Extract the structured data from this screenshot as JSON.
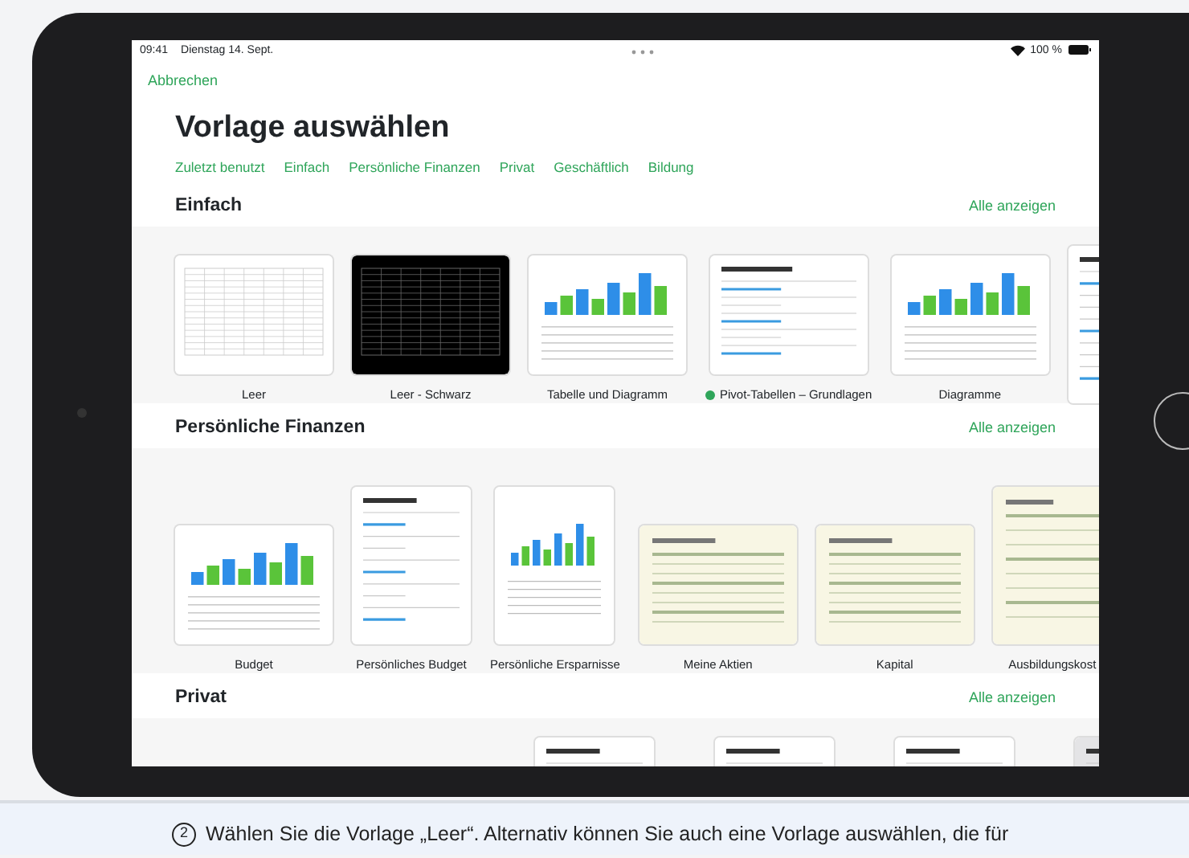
{
  "status_bar": {
    "time": "09:41",
    "date": "Dienstag 14. Sept.",
    "battery": "100 %"
  },
  "cancel": "Abbrechen",
  "title": "Vorlage auswählen",
  "categories": [
    "Zuletzt benutzt",
    "Einfach",
    "Persönliche Finanzen",
    "Privat",
    "Geschäftlich",
    "Bildung"
  ],
  "sections": [
    {
      "title": "Einfach",
      "show_all": "Alle anzeigen",
      "templates": [
        {
          "label": "Leer",
          "kind": "grid",
          "marked": false
        },
        {
          "label": "Leer - Schwarz",
          "kind": "grid-dark",
          "marked": false
        },
        {
          "label": "Tabelle und Diagramm",
          "kind": "chart",
          "marked": false
        },
        {
          "label": "Pivot-Tabellen – Grundlagen",
          "kind": "doc",
          "marked": true
        },
        {
          "label": "Diagramme",
          "kind": "chart",
          "marked": false
        },
        {
          "kind": "doc-page",
          "marked": false
        }
      ]
    },
    {
      "title": "Persönliche Finanzen",
      "show_all": "Alle anzeigen",
      "templates": [
        {
          "label": "Budget",
          "kind": "chart",
          "marked": false
        },
        {
          "label": "Persönliches Budget",
          "kind": "doc-page",
          "marked": false
        },
        {
          "label": "Persönliche Ersparnisse",
          "kind": "chart-page",
          "marked": false
        },
        {
          "label": "Meine Aktien",
          "kind": "cream",
          "marked": false
        },
        {
          "label": "Kapital",
          "kind": "cream",
          "marked": false
        },
        {
          "label": "Ausbildungskost",
          "kind": "cream-page",
          "marked": false
        }
      ]
    },
    {
      "title": "Privat",
      "show_all": "Alle anzeigen",
      "templates": [
        {
          "kind": "doc-page",
          "marked": false
        },
        {
          "kind": "doc-page",
          "marked": false
        },
        {
          "kind": "doc-page",
          "marked": false
        },
        {
          "kind": "grey-page",
          "marked": false
        }
      ]
    }
  ],
  "caption": {
    "step": "2",
    "text": "Wählen Sie die Vorlage „Leer“. Alternativ können Sie auch eine Vorlage auswählen, die für"
  }
}
